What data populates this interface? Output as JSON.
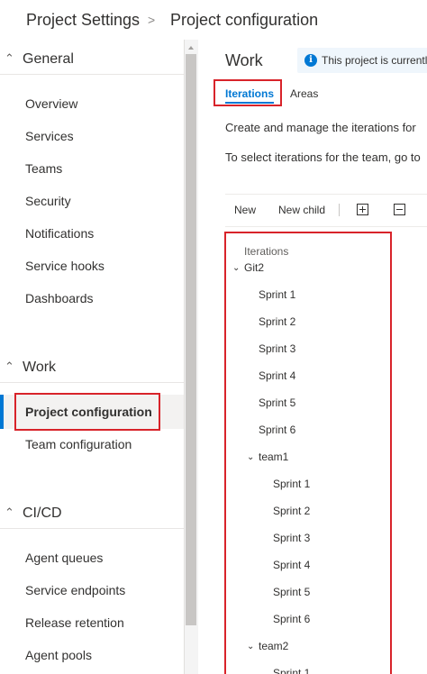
{
  "breadcrumb": {
    "root": "Project Settings",
    "separator": ">",
    "current": "Project configuration"
  },
  "sidebar": {
    "general": {
      "title": "General",
      "items": [
        "Overview",
        "Services",
        "Teams",
        "Security",
        "Notifications",
        "Service hooks",
        "Dashboards"
      ]
    },
    "work": {
      "title": "Work",
      "items": [
        "Project configuration",
        "Team configuration"
      ]
    },
    "cicd": {
      "title": "CI/CD",
      "items": [
        "Agent queues",
        "Service endpoints",
        "Release retention",
        "Agent pools"
      ]
    }
  },
  "main": {
    "title": "Work",
    "banner": "This project is currently",
    "tabs": [
      "Iterations",
      "Areas"
    ],
    "desc1": "Create and manage the iterations for",
    "desc2": "To select iterations for the team, go to",
    "toolbar": {
      "new": "New",
      "new_child": "New child"
    },
    "tree": {
      "header": "Iterations",
      "root": "Git2",
      "root_sprints": [
        "Sprint 1",
        "Sprint 2",
        "Sprint 3",
        "Sprint 4",
        "Sprint 5",
        "Sprint 6"
      ],
      "team1": "team1",
      "team1_sprints": [
        "Sprint 1",
        "Sprint 2",
        "Sprint 3",
        "Sprint 4",
        "Sprint 5",
        "Sprint 6"
      ],
      "team2": "team2",
      "team2_sprints": [
        "Sprint 1"
      ]
    }
  },
  "colors": {
    "accent": "#0078d4",
    "highlight": "#d8232a"
  }
}
